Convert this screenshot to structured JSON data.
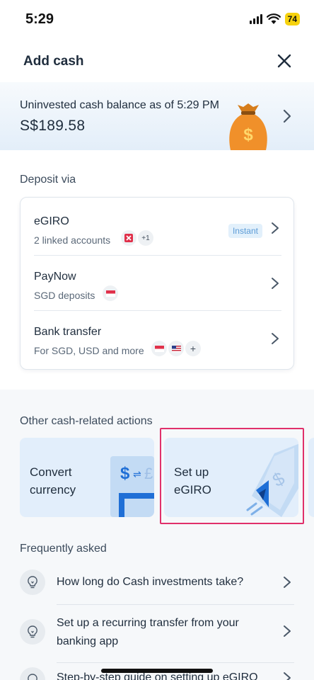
{
  "status_bar": {
    "time": "5:29",
    "battery": "74"
  },
  "header": {
    "title": "Add cash",
    "close_icon": "close-icon"
  },
  "balance": {
    "label": "Uninvested cash balance as of 5:29 PM",
    "value": "S$189.58",
    "icon": "money-bag-icon"
  },
  "deposit": {
    "section_title": "Deposit via",
    "methods": [
      {
        "title": "eGIRO",
        "subtitle": "2 linked accounts",
        "badge_extra": "+1",
        "tag": "Instant"
      },
      {
        "title": "PayNow",
        "subtitle": "SGD deposits"
      },
      {
        "title": "Bank transfer",
        "subtitle": "For SGD, USD and more",
        "badge_extra": "+"
      }
    ]
  },
  "other_actions": {
    "section_title": "Other cash-related actions",
    "cards": [
      {
        "label": "Convert currency",
        "line1": "Convert",
        "line2": "currency"
      },
      {
        "label": "Set up eGIRO",
        "line1": "Set up",
        "line2": "eGIRO"
      }
    ]
  },
  "faq": {
    "section_title": "Frequently asked",
    "items": [
      {
        "question": "How long do Cash investments take?"
      },
      {
        "question": "Set up a recurring transfer from your banking app"
      },
      {
        "question": "Step-by-step guide on setting up eGIRO"
      }
    ]
  },
  "colors": {
    "accent_blue": "#1f6fd6",
    "card_bg": "#e2eefb",
    "highlight": "#e0306a",
    "bag_orange": "#f0902a",
    "instant_text": "#5c9bd6"
  }
}
